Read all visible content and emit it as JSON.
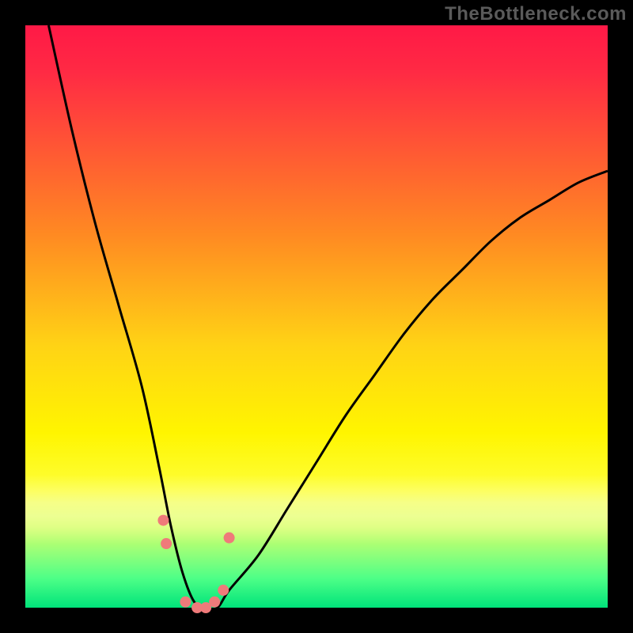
{
  "watermark": "TheBottleneck.com",
  "chart_data": {
    "type": "line",
    "title": "",
    "xlabel": "",
    "ylabel": "",
    "xlim": [
      0,
      100
    ],
    "ylim": [
      0,
      100
    ],
    "grid": false,
    "series": [
      {
        "name": "bottleneck-curve",
        "color": "#000000",
        "x": [
          4,
          8,
          12,
          16,
          20,
          23,
          25,
          27,
          29,
          31,
          33,
          35,
          40,
          45,
          50,
          55,
          60,
          65,
          70,
          75,
          80,
          85,
          90,
          95,
          100
        ],
        "y": [
          100,
          82,
          66,
          52,
          38,
          24,
          14,
          6,
          1,
          0,
          0,
          3,
          9,
          17,
          25,
          33,
          40,
          47,
          53,
          58,
          63,
          67,
          70,
          73,
          75
        ]
      }
    ],
    "markers": {
      "name": "highlight-points",
      "color": "#ef7a7a",
      "radius_px": 7,
      "points": [
        {
          "x": 23.7,
          "y": 15
        },
        {
          "x": 24.2,
          "y": 11
        },
        {
          "x": 27.5,
          "y": 1
        },
        {
          "x": 29.5,
          "y": 0
        },
        {
          "x": 31.0,
          "y": 0
        },
        {
          "x": 32.5,
          "y": 1
        },
        {
          "x": 34.0,
          "y": 3
        },
        {
          "x": 35.0,
          "y": 12
        }
      ]
    },
    "background_gradient": {
      "orientation": "vertical",
      "stops": [
        {
          "pos": 0.0,
          "hex": "#ff1946"
        },
        {
          "pos": 0.55,
          "hex": "#ffd315"
        },
        {
          "pos": 0.8,
          "hex": "#fdff3a"
        },
        {
          "pos": 1.0,
          "hex": "#00e37a"
        }
      ]
    }
  }
}
